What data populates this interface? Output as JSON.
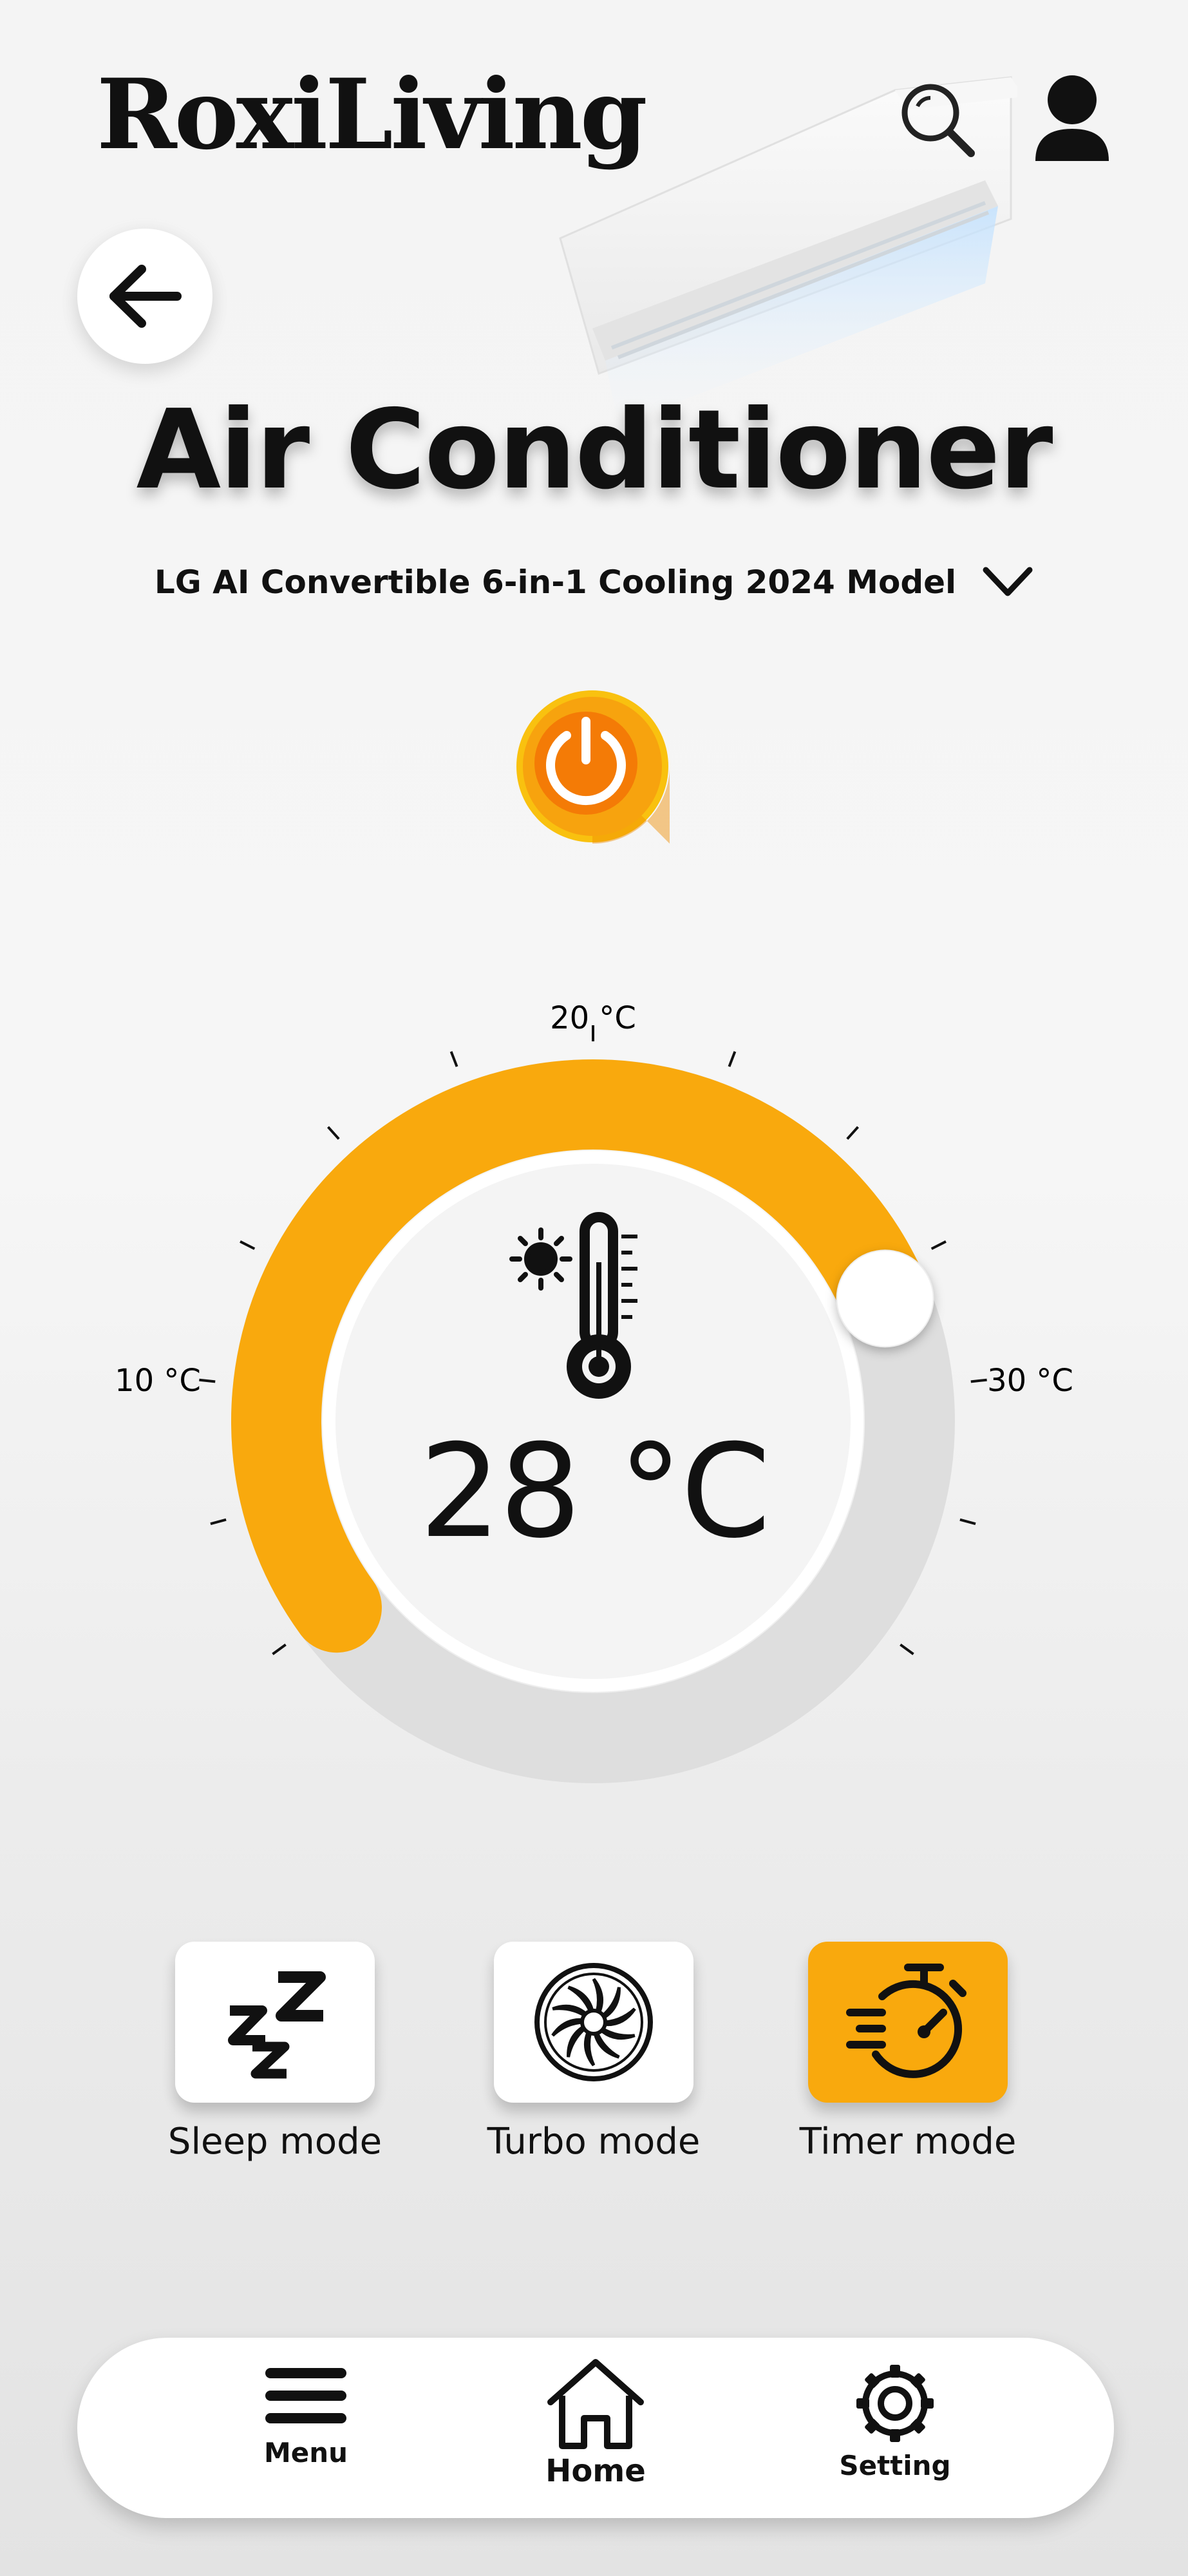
{
  "app": {
    "brand": "RoxiLiving"
  },
  "header": {
    "search_icon": "search-icon",
    "user_icon": "user-icon",
    "back_icon": "arrow-left-icon"
  },
  "page": {
    "title": "Air Conditioner",
    "model": "LG AI Convertible 6-in-1 Cooling 2024 Model",
    "model_dropdown_icon": "chevron-down-icon"
  },
  "power": {
    "icon": "power-icon",
    "state": "on"
  },
  "thermostat": {
    "temperature": "28 °C",
    "value": 28,
    "min": 5,
    "max": 35,
    "tick_labels": {
      "low": "10 °C",
      "mid": "20 °C",
      "high": "30 °C"
    },
    "icon": "thermometer-sun-icon"
  },
  "modes": [
    {
      "label": "Sleep mode",
      "icon": "sleep-zzz-icon",
      "active": false
    },
    {
      "label": "Turbo mode",
      "icon": "turbo-fan-icon",
      "active": false
    },
    {
      "label": "Timer mode",
      "icon": "stopwatch-icon",
      "active": true
    }
  ],
  "nav": [
    {
      "label": "Menu",
      "icon": "menu-icon"
    },
    {
      "label": "Home",
      "icon": "home-icon"
    },
    {
      "label": "Setting",
      "icon": "gear-icon"
    }
  ],
  "colors": {
    "accent": "#f9a90d",
    "power_orange": "#f57c00",
    "track": "#dcdcdc"
  }
}
